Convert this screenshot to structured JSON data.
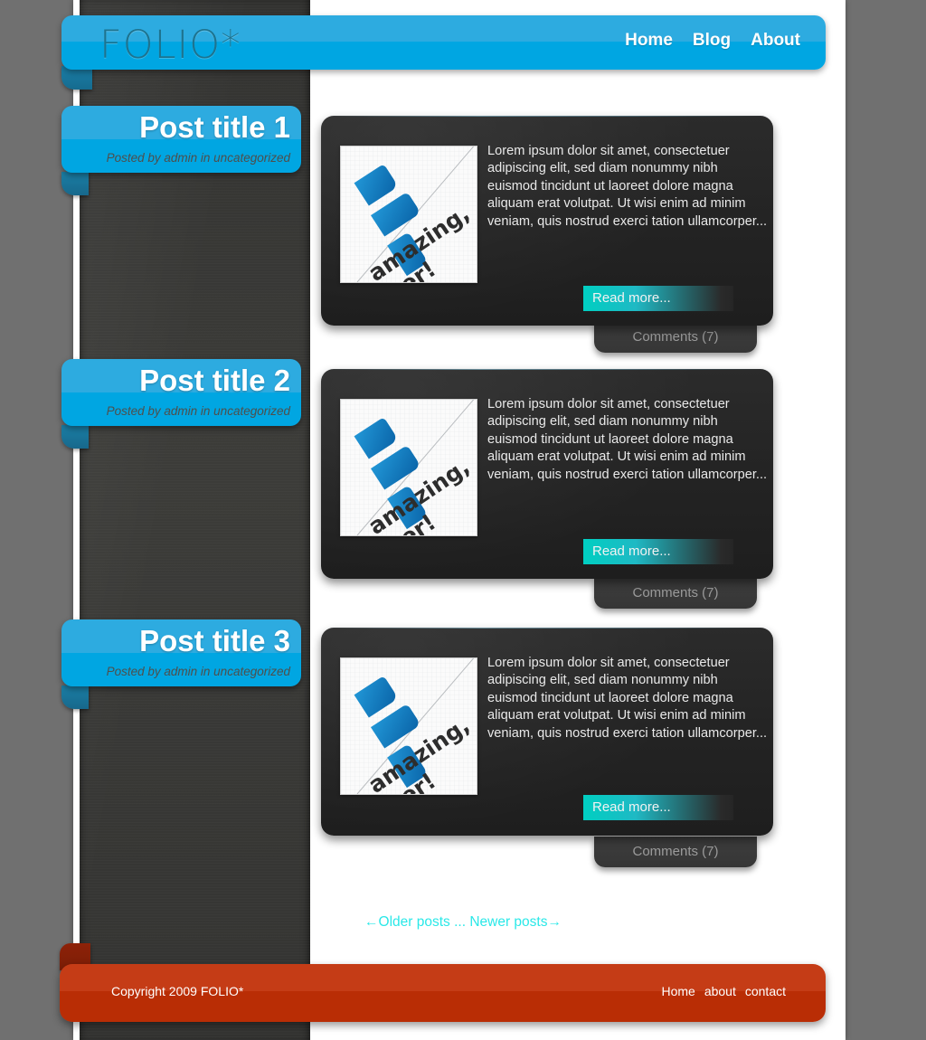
{
  "site": {
    "logo": "FOLIO*",
    "background_color": "#707070",
    "accent_blue": "#00a6e2",
    "accent_blue_light": "#2dabe0",
    "accent_teal": "#00cfc2",
    "accent_cyan": "#2ae8e8",
    "footer_red": "#b92d05",
    "dark_panel": "#232323"
  },
  "nav": {
    "items": [
      {
        "label": "Home"
      },
      {
        "label": "Blog"
      },
      {
        "label": "About"
      }
    ]
  },
  "posts": [
    {
      "title": "Post title 1",
      "meta": "Posted by admin in uncategorized",
      "excerpt": "Lorem ipsum dolor sit amet, consectetuer adipiscing elit, sed diam nonummy nibh euismod tincidunt ut laoreet dolore magna aliquam erat volutpat. Ut wisi enim ad minim veniam, quis nostrud  exerci tation ullamcorper...",
      "read_more": "Read more...",
      "comments": "Comments (7)",
      "thumbnail": {
        "alt": "amazing-poster-thumbnail",
        "caption_line1": "amazing,",
        "caption_line2": "er!"
      }
    },
    {
      "title": "Post title 2",
      "meta": "Posted by admin in uncategorized",
      "excerpt": "Lorem ipsum dolor sit amet, consectetuer adipiscing elit, sed diam nonummy nibh euismod tincidunt ut laoreet dolore magna aliquam erat volutpat. Ut wisi enim ad minim veniam, quis nostrud  exerci tation ullamcorper...",
      "read_more": "Read more...",
      "comments": "Comments (7)",
      "thumbnail": {
        "alt": "amazing-poster-thumbnail",
        "caption_line1": "amazing,",
        "caption_line2": "er!"
      }
    },
    {
      "title": "Post title 3",
      "meta": "Posted by admin in uncategorized",
      "excerpt": "Lorem ipsum dolor sit amet, consectetuer adipiscing elit, sed diam nonummy nibh euismod tincidunt ut laoreet dolore magna aliquam erat volutpat. Ut wisi enim ad minim veniam, quis nostrud  exerci tation ullamcorper...",
      "read_more": "Read more...",
      "comments": "Comments (7)",
      "thumbnail": {
        "alt": "amazing-poster-thumbnail",
        "caption_line1": "amazing,",
        "caption_line2": "er!"
      }
    }
  ],
  "pagination": {
    "older": "←Older posts",
    "separator": " ... ",
    "newer": "Newer posts→"
  },
  "footer": {
    "copyright": "Copyright 2009 FOLIO*",
    "links": [
      {
        "label": "Home"
      },
      {
        "label": "about"
      },
      {
        "label": "contact"
      }
    ]
  }
}
